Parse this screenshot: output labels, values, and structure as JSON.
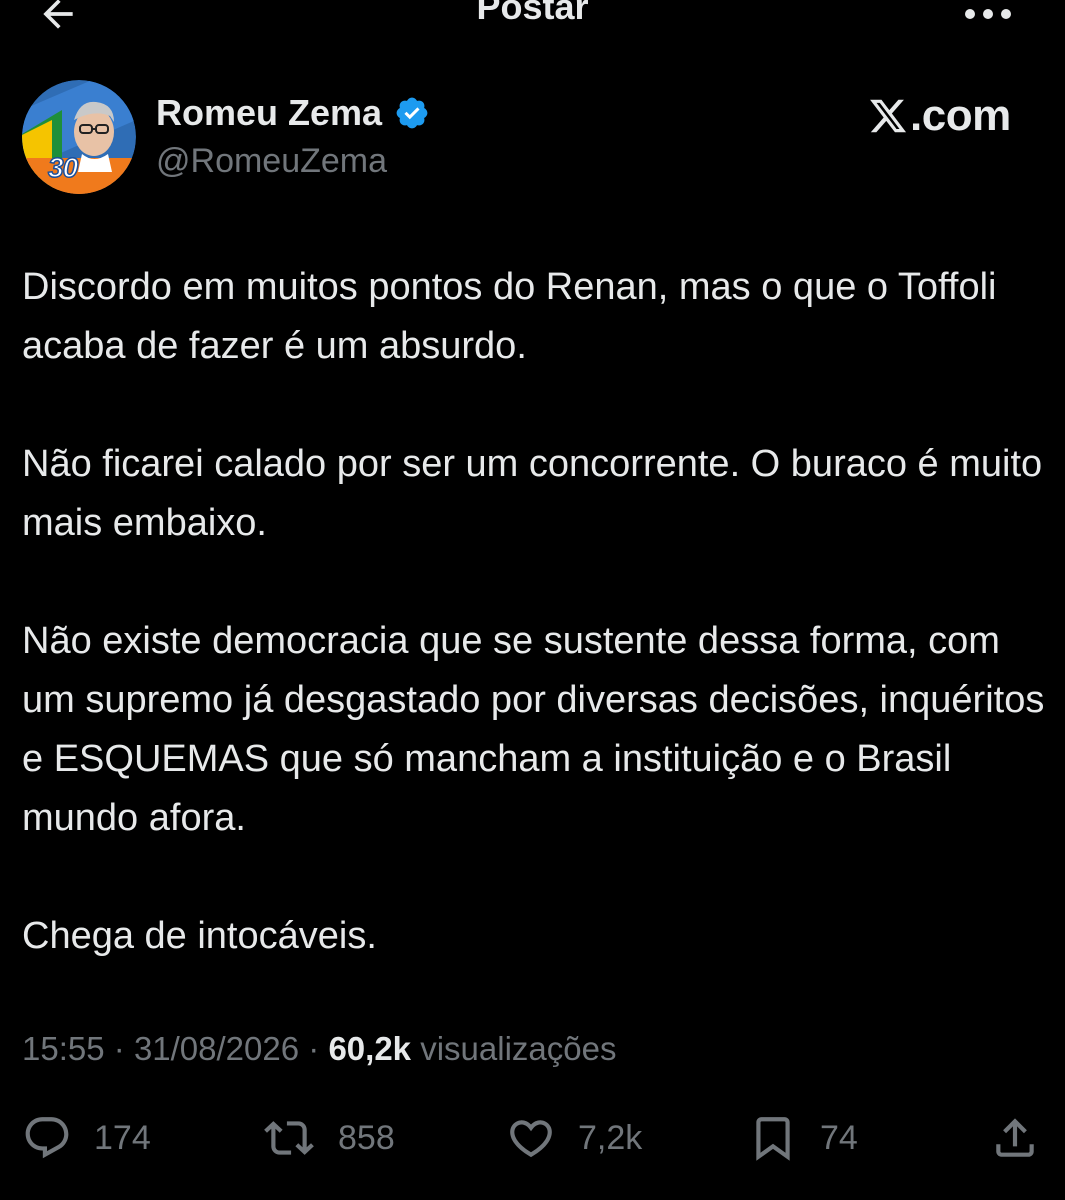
{
  "header": {
    "title": "Postar",
    "back_icon": "arrow-left-icon",
    "more_icon": "more-horizontal-icon"
  },
  "author": {
    "display_name": "Romeu Zema",
    "handle": "@RomeuZema",
    "verified": true,
    "avatar_badge_text": "30"
  },
  "watermark": {
    "text": ".com",
    "logo": "x-logo-icon"
  },
  "tweet": {
    "paragraphs": [
      "Discordo em muitos pontos do Renan, mas o que o Toffoli acaba de fazer é um absurdo.",
      "Não ficarei calado por ser um concorrente. O buraco é muito mais embaixo.",
      "Não existe democracia que se sustente dessa forma, com um supremo já desgastado por diversas decisões, inquéritos e ESQUEMAS que só mancham a instituição e o Brasil mundo afora.",
      "Chega de intocáveis."
    ]
  },
  "meta": {
    "time": "15:55",
    "date": "31/08/2026",
    "separator": "·",
    "views_count": "60,2k",
    "views_label": "visualizações"
  },
  "actions": {
    "replies": "174",
    "reposts": "858",
    "likes": "7,2k",
    "bookmarks": "74"
  },
  "colors": {
    "background": "#000000",
    "text_primary": "#e7e9ea",
    "text_secondary": "#71767b",
    "verified_blue": "#1d9bf0"
  }
}
